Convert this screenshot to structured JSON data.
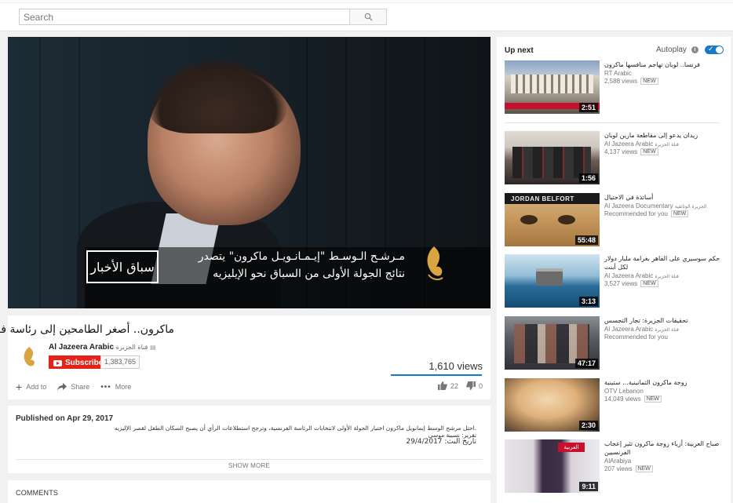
{
  "search": {
    "placeholder": "Search"
  },
  "player": {
    "news_tag": "سباق الأخبار",
    "caption_line1": "مـرشـح الـوسـط \"إيـمـانـويـل ماكرون\" يتصدر",
    "caption_line2": "نتائج الجولة الأولى من السباق نحو الإيليزيه"
  },
  "video": {
    "title": "ماكرون.. أصغر الطامحين إلى رئاسة فرنسا",
    "channel_en": "Al Jazeera Arabic",
    "channel_ar": "قناة الجزيرة",
    "subscribe_label": "Subscribe",
    "subscriber_count": "1,383,765",
    "views": "1,610 views",
    "actions": {
      "add_to": "Add to",
      "share": "Share",
      "more": "More"
    },
    "likes": "22",
    "dislikes": "0"
  },
  "description": {
    "published": "Published on Apr 29, 2017",
    "line1": "احتل مرشح الوسط إيمانويل ماكرون اختيار الجولة الأولى لانتخابات الرئاسة الفرنسية، وترجح استطلاعات الرأي أن يصبح السكان الطفل لقصر الإليزيه.",
    "line2": "تقرير: نسيبة موسى",
    "line3": "تاريخ البث: 29/4/2017",
    "show_more": "SHOW MORE"
  },
  "comments": {
    "title": "COMMENTS"
  },
  "sidebar": {
    "up_next": "Up next",
    "autoplay": "Autoplay",
    "items": [
      {
        "title": "فرنسا.. لوبان تهاجم منافسها ماكرون",
        "channel": "RT Arabic",
        "channel_ar": "",
        "views": "2,588 views",
        "badge": "NEW",
        "duration": "2:51"
      },
      {
        "title": "زيدان يدعو إلى مقاطعة مارين لوبان",
        "channel": "Al Jazeera Arabic",
        "channel_ar": "قناة الجزيرة",
        "views": "4,137 views",
        "badge": "NEW",
        "duration": "1:56"
      },
      {
        "title": "أساتذة في الاحتيال",
        "channel": "Al Jazeera Documentary",
        "channel_ar": "الجزيرة الوثائقية",
        "views": "Recommended for you",
        "badge": "NEW",
        "duration": "55:48",
        "thumb_text": "JORDAN BELFORT"
      },
      {
        "title": "حكم سوسيري على الفاهر بغرامة مليار دولار لكل أبنت",
        "channel": "Al Jazeera Arabic",
        "channel_ar": "قناة الجزيرة",
        "views": "3,527 views",
        "badge": "NEW",
        "duration": "3:13"
      },
      {
        "title": "تحقيقات الجزيرة: تجار التجسس",
        "channel": "Al Jazeera Arabic",
        "channel_ar": "قناة الجزيرة",
        "views": "Recommended for you",
        "badge": "",
        "duration": "47:17"
      },
      {
        "title": "زوجة ماكرون الثمانينية... ستينية",
        "channel": "OTV Lebanon",
        "channel_ar": "",
        "views": "14,049 views",
        "badge": "NEW",
        "duration": "2:30"
      },
      {
        "title": "صباح العربية: أزياء زوجة ماكرون تثير إعجاب الفرنسيين",
        "channel": "AlArabiya",
        "channel_ar": "",
        "views": "207 views",
        "badge": "NEW",
        "duration": "9:11",
        "thumb_text": "العربية"
      }
    ]
  },
  "colors": {
    "subscribe_red": "#e62117",
    "accent_blue": "#167ac6"
  }
}
